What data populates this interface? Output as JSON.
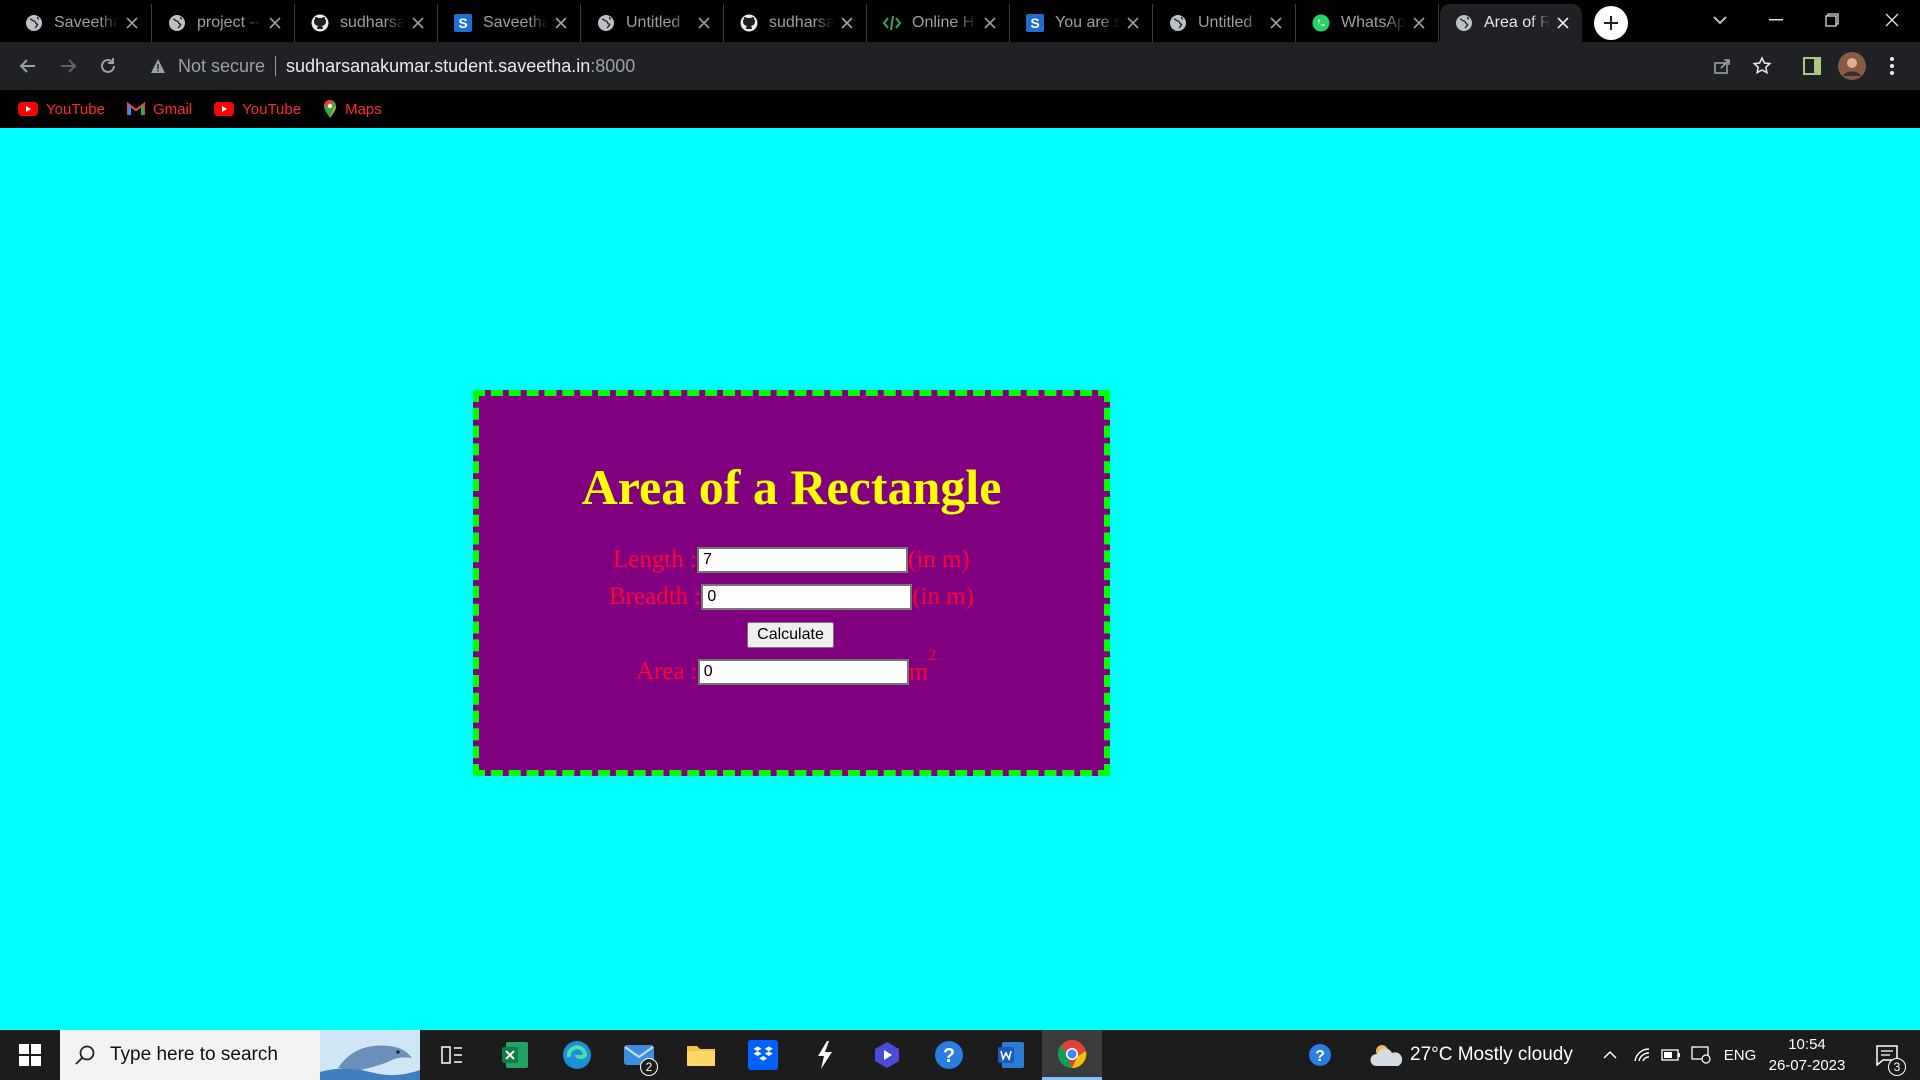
{
  "browser": {
    "tabs": [
      {
        "title": "Saveetha",
        "favicon": "globe-icon"
      },
      {
        "title": "project -- ",
        "favicon": "globe-icon"
      },
      {
        "title": "sudharsanakumar",
        "favicon": "github-icon"
      },
      {
        "title": "Saveetha",
        "favicon": "s-square-icon"
      },
      {
        "title": "Untitled",
        "favicon": "globe-icon"
      },
      {
        "title": "sudharsanakumar",
        "favicon": "github-icon"
      },
      {
        "title": "Online H",
        "favicon": "code-icon"
      },
      {
        "title": "You are s",
        "favicon": "s-square-icon"
      },
      {
        "title": "Untitled",
        "favicon": "globe-icon"
      },
      {
        "title": "WhatsApp",
        "favicon": "whatsapp-icon"
      },
      {
        "title": "Area of R",
        "favicon": "globe-icon",
        "active": true
      }
    ],
    "address": {
      "security_text": "Not secure",
      "host": "sudharsanakumar.student.saveetha.in",
      "port": ":8000"
    },
    "bookmarks": [
      {
        "label": "YouTube",
        "icon": "youtube-icon"
      },
      {
        "label": "Gmail",
        "icon": "gmail-icon"
      },
      {
        "label": "YouTube",
        "icon": "youtube-icon"
      },
      {
        "label": "Maps",
        "icon": "maps-icon"
      }
    ]
  },
  "page": {
    "title": "Area of a Rectangle",
    "length": {
      "label": "Length : ",
      "value": "7",
      "unit": "(in m)"
    },
    "breadth": {
      "label": "Breadth : ",
      "value": "0",
      "unit": "(in m)"
    },
    "calculate_label": "Calculate",
    "area": {
      "label": "Area : ",
      "value": "0",
      "unit": "m",
      "unit_sup": "2"
    },
    "colors": {
      "background": "#00ffff",
      "card": "#800080",
      "border": "#00ff00",
      "title": "#ffff00",
      "labels": "#ff0033"
    }
  },
  "taskbar": {
    "search_placeholder": "Type here to search",
    "mail_badge": "2",
    "weather": "27°C  Mostly cloudy",
    "language": "ENG",
    "time": "10:54",
    "date": "26-07-2023",
    "notification_count": "3"
  }
}
